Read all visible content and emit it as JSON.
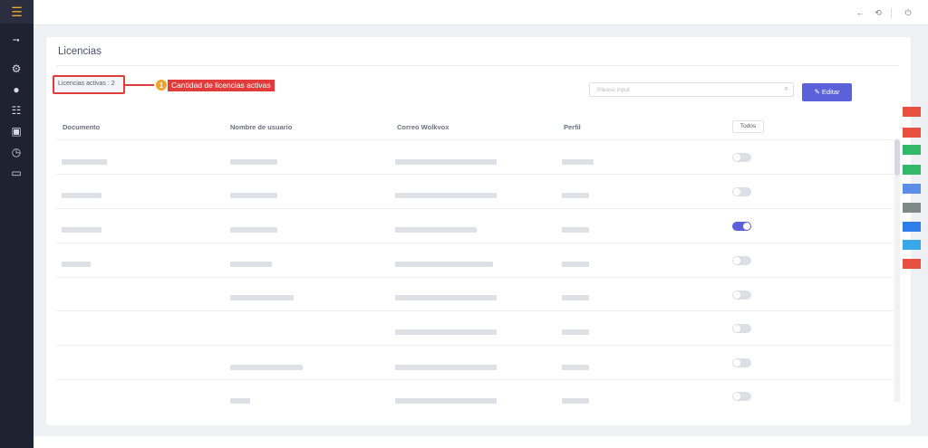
{
  "sidebar": {
    "menu_icon": "hamburger-menu-icon",
    "icons": [
      "settings-icon",
      "user-icon",
      "list-icon",
      "id-card-icon",
      "history-icon",
      "calendar-icon"
    ]
  },
  "topbar": {
    "icons": [
      "back-icon",
      "refresh-icon",
      "power-icon"
    ]
  },
  "page": {
    "title": "Licencias",
    "licenses_label": "Licencias activas : 2",
    "callout_number": "1",
    "callout_text": "Cantidad de licencias activas"
  },
  "search": {
    "placeholder": "Please input",
    "value": ""
  },
  "edit_button": {
    "icon": "✎",
    "label": "Editar"
  },
  "table": {
    "headers": [
      "Documento",
      "Nombre de usuario",
      "Correo Wolkvox",
      "Perfil"
    ],
    "filter_label": "Todos",
    "rows": [
      {
        "active": false
      },
      {
        "active": false
      },
      {
        "active": true
      },
      {
        "active": false
      },
      {
        "active": false
      },
      {
        "active": false
      },
      {
        "active": false
      },
      {
        "active": false
      }
    ]
  },
  "colors": {
    "accent": "#5b62d9",
    "annotation": "#e23b3b",
    "badge": "#f2a12b",
    "sidebar": "#1f2230"
  }
}
